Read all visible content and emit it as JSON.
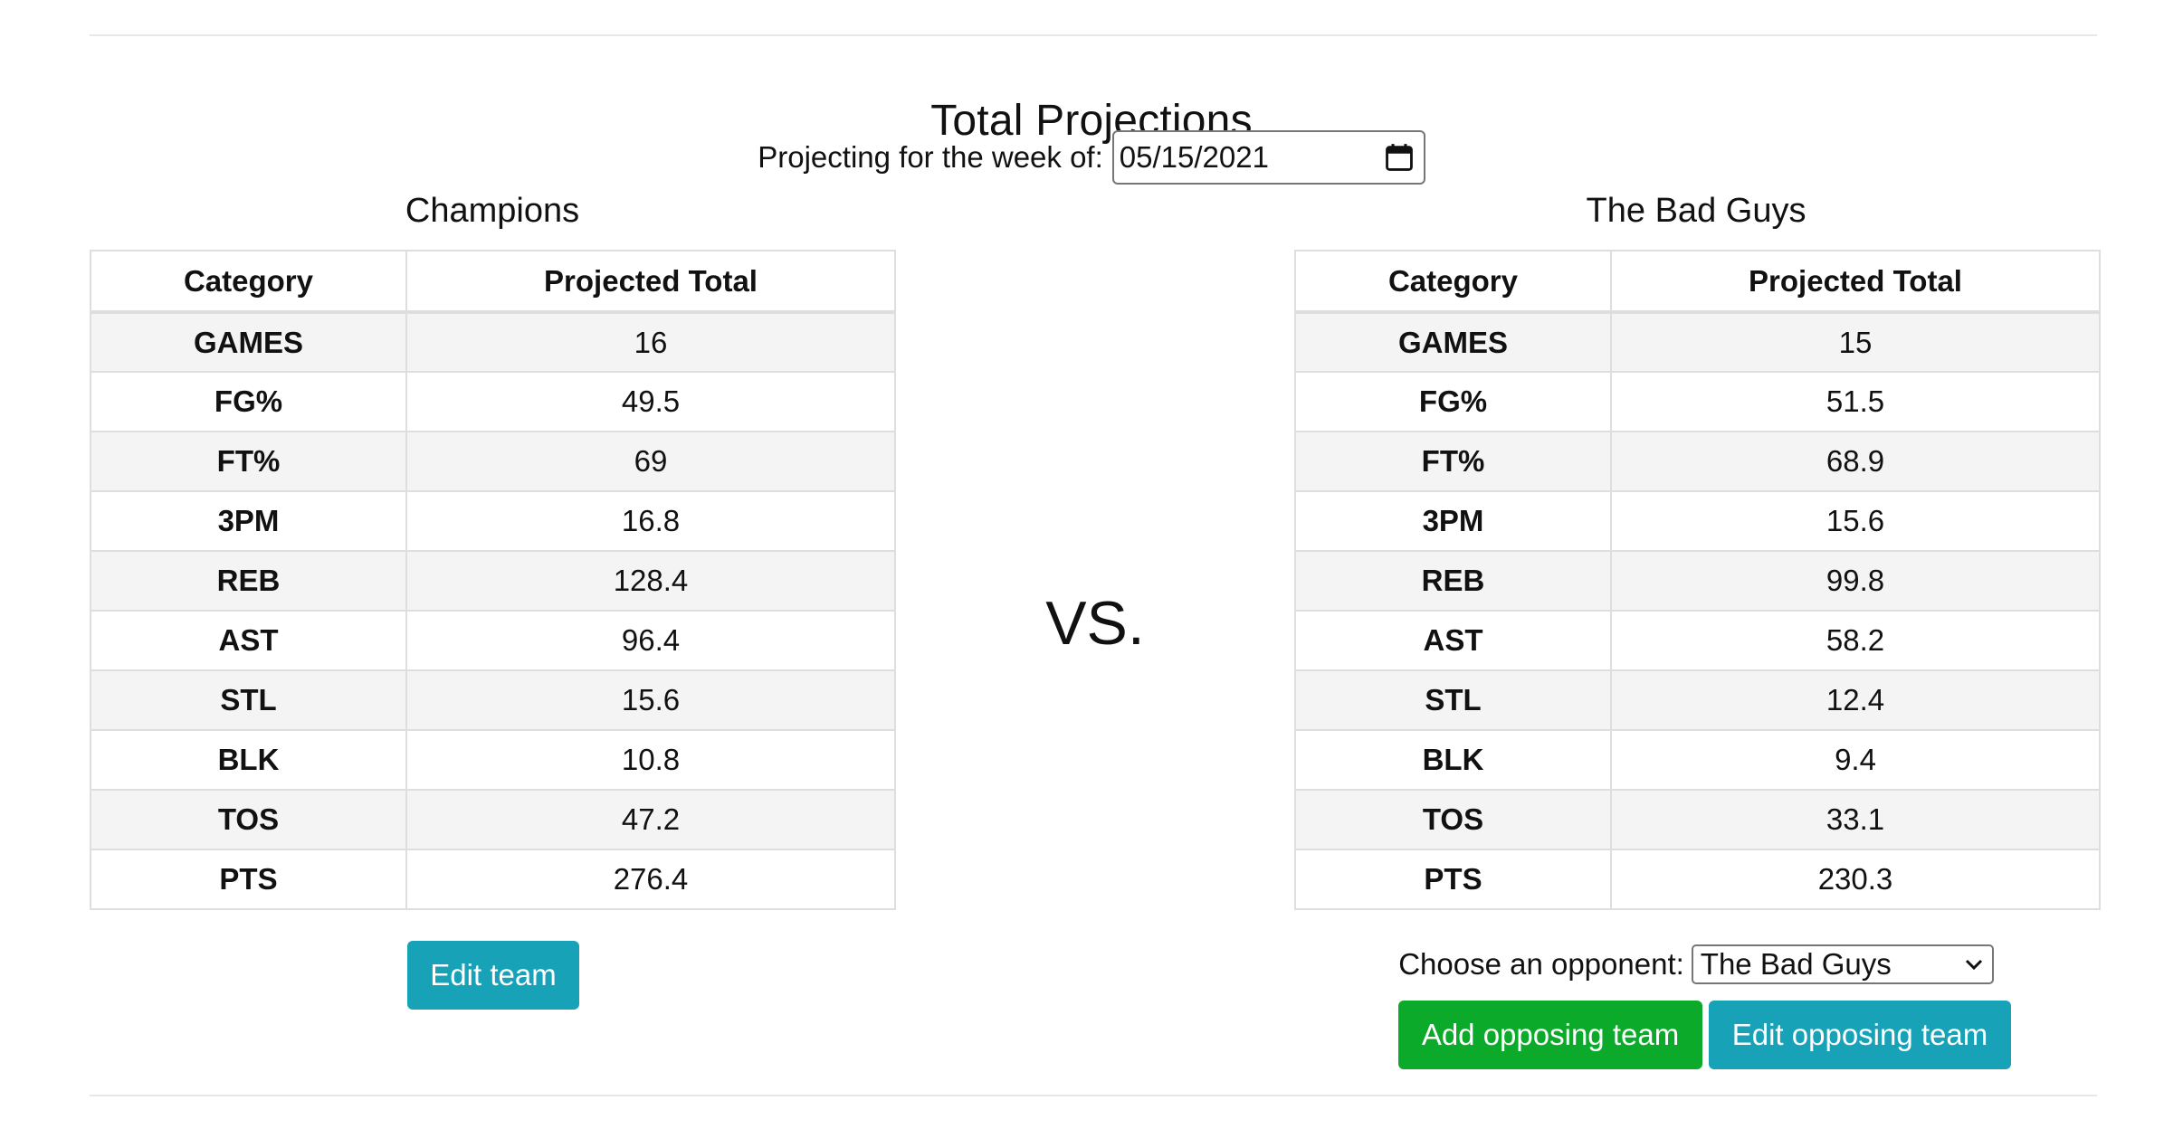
{
  "page": {
    "title": "Total Projections",
    "date_label": "Projecting for the week of:",
    "date_value": "05/15/2021",
    "vs_text": "VS."
  },
  "table_headers": {
    "category": "Category",
    "projected_total": "Projected Total"
  },
  "team_left": {
    "name": "Champions",
    "rows": [
      {
        "category": "GAMES",
        "total": "16"
      },
      {
        "category": "FG%",
        "total": "49.5"
      },
      {
        "category": "FT%",
        "total": "69"
      },
      {
        "category": "3PM",
        "total": "16.8"
      },
      {
        "category": "REB",
        "total": "128.4"
      },
      {
        "category": "AST",
        "total": "96.4"
      },
      {
        "category": "STL",
        "total": "15.6"
      },
      {
        "category": "BLK",
        "total": "10.8"
      },
      {
        "category": "TOS",
        "total": "47.2"
      },
      {
        "category": "PTS",
        "total": "276.4"
      }
    ],
    "edit_label": "Edit team"
  },
  "team_right": {
    "name": "The Bad Guys",
    "rows": [
      {
        "category": "GAMES",
        "total": "15"
      },
      {
        "category": "FG%",
        "total": "51.5"
      },
      {
        "category": "FT%",
        "total": "68.9"
      },
      {
        "category": "3PM",
        "total": "15.6"
      },
      {
        "category": "REB",
        "total": "99.8"
      },
      {
        "category": "AST",
        "total": "58.2"
      },
      {
        "category": "STL",
        "total": "12.4"
      },
      {
        "category": "BLK",
        "total": "9.4"
      },
      {
        "category": "TOS",
        "total": "33.1"
      },
      {
        "category": "PTS",
        "total": "230.3"
      }
    ],
    "opponent_label": "Choose an opponent:",
    "opponent_selected": "The Bad Guys",
    "add_label": "Add opposing team",
    "edit_label": "Edit opposing team"
  },
  "icons": {
    "date": "calendar-icon",
    "select": "chevron-down-icon"
  },
  "colors": {
    "info_button": "#17a2b8",
    "success_button": "#0caa2a",
    "striped_row": "#f4f4f4",
    "border": "#dedede"
  }
}
